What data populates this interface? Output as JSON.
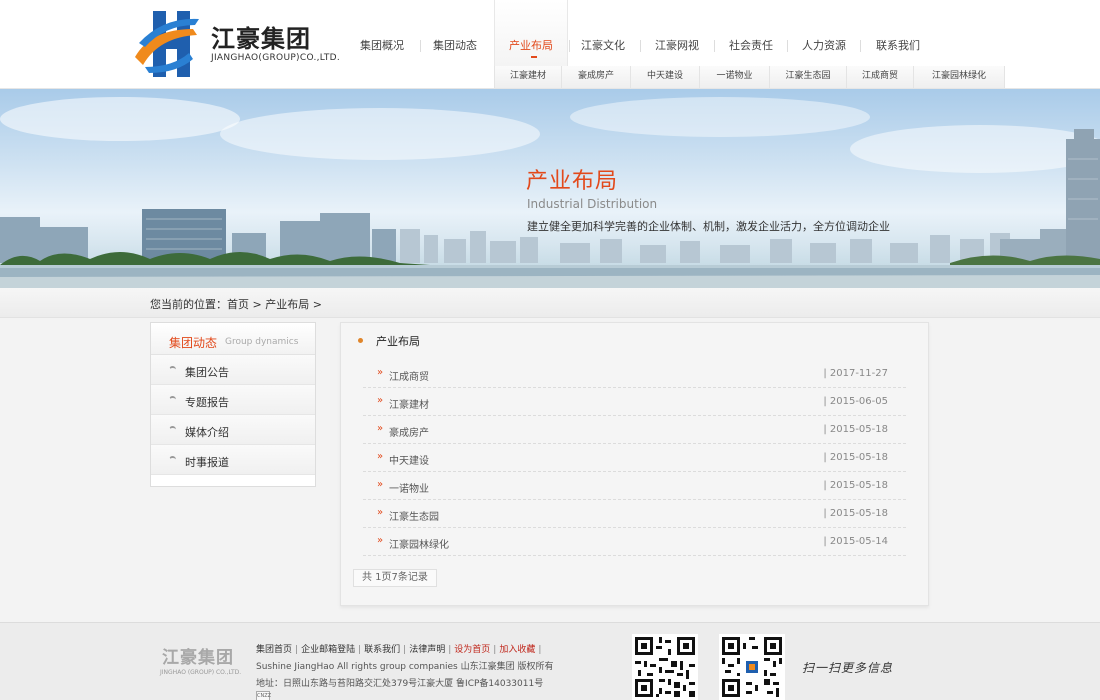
{
  "header": {
    "logo_cn": "江豪集团",
    "logo_en": "JIANGHAO(GROUP)CO.,LTD.",
    "nav": [
      "集团概况",
      "集团动态",
      "产业布局",
      "江豪文化",
      "江豪网视",
      "社会责任",
      "人力资源",
      "联系我们"
    ],
    "nav_active_index": 2,
    "subnav": [
      "江豪建材",
      "豪成房产",
      "中天建设",
      "一诺物业",
      "江豪生态园",
      "江成商贸",
      "江豪园林绿化"
    ],
    "accent_color": "#e2491b"
  },
  "banner": {
    "title": "产业布局",
    "subtitle_en": "Industrial Distribution",
    "description": "建立健全更加科学完善的企业体制、机制，激发企业活力，全方位调动企业"
  },
  "breadcrumb": {
    "prefix": "您当前的位置：",
    "home": "首页",
    "sep": ">",
    "current": "产业布局"
  },
  "sidebar": {
    "title_cn": "集团动态",
    "title_en": "Group dynamics",
    "items": [
      "集团公告",
      "专题报告",
      "媒体介绍",
      "时事报道"
    ]
  },
  "main": {
    "title": "产业布局",
    "arrow": "»",
    "rows": [
      {
        "title": "江成商贸",
        "date": "| 2017-11-27"
      },
      {
        "title": "江豪建材",
        "date": "| 2015-06-05"
      },
      {
        "title": "豪成房产",
        "date": "| 2015-05-18"
      },
      {
        "title": "中天建设",
        "date": "| 2015-05-18"
      },
      {
        "title": "一诺物业",
        "date": "| 2015-05-18"
      },
      {
        "title": "江豪生态园",
        "date": "| 2015-05-18"
      },
      {
        "title": "江豪园林绿化",
        "date": "| 2015-05-14"
      }
    ],
    "pager": "共 1页7条记录"
  },
  "footer": {
    "logo_cn": "江豪集团",
    "logo_en": "JINGHAO (GROUP) CO.,LTD.",
    "links": [
      {
        "label": "集团首页",
        "highlight": false
      },
      {
        "label": "企业邮箱登陆",
        "highlight": false
      },
      {
        "label": "联系我们",
        "highlight": false
      },
      {
        "label": "法律声明",
        "highlight": false
      },
      {
        "label": "设为首页",
        "highlight": true
      },
      {
        "label": "加入收藏",
        "highlight": true
      }
    ],
    "link_sep": "|",
    "copyright": "Sushine JiangHao All rights group companies 山东江豪集团 版权所有",
    "address": "地址：日照山东路与苔阳路交汇处379号江豪大厦 鲁ICP备14033011号",
    "badge": "CNZZ",
    "slogan": "扫一扫更多信息"
  }
}
